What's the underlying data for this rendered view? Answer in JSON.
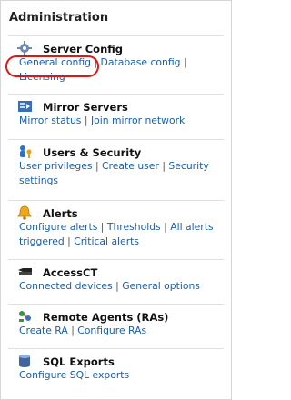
{
  "panel": {
    "title": "Administration"
  },
  "sections": [
    {
      "title": "Server Config",
      "icon": "gear-icon",
      "links": [
        "General config",
        "Database config",
        "Licensing"
      ]
    },
    {
      "title": "Mirror Servers",
      "icon": "mirror-servers-icon",
      "links": [
        "Mirror status",
        "Join mirror network"
      ]
    },
    {
      "title": "Users & Security",
      "icon": "user-key-icon",
      "links": [
        "User privileges",
        "Create user",
        "Security settings"
      ]
    },
    {
      "title": "Alerts",
      "icon": "bell-icon",
      "links": [
        "Configure alerts",
        "Thresholds",
        "All alerts triggered",
        "Critical alerts"
      ]
    },
    {
      "title": "AccessCT",
      "icon": "device-icon",
      "links": [
        "Connected devices",
        "General options"
      ]
    },
    {
      "title": "Remote Agents (RAs)",
      "icon": "remote-agents-icon",
      "links": [
        "Create RA",
        "Configure RAs"
      ]
    },
    {
      "title": "SQL Exports",
      "icon": "database-icon",
      "links": [
        "Configure SQL exports"
      ]
    }
  ],
  "separator": "|",
  "colors": {
    "link": "#1a5fa8",
    "highlight": "#e01515"
  }
}
